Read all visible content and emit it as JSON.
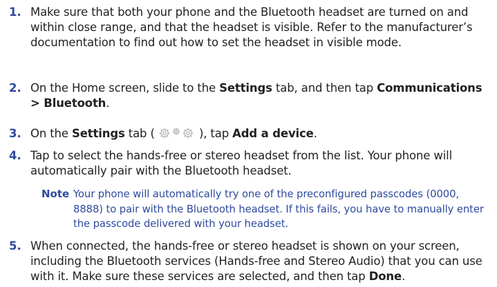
{
  "steps": [
    {
      "number": "1.",
      "text": "Make sure that both your phone and the Bluetooth headset are turned on and within close range, and that the headset is visible. Refer to the manufacturer’s documentation to find out how to set the headset in visible mode."
    },
    {
      "number": "2.",
      "part_a": "On the Home screen, slide to the ",
      "bold_a": "Settings",
      "part_b": " tab, and then tap ",
      "bold_b": "Communications > Bluetooth",
      "part_c": "."
    },
    {
      "number": "3.",
      "part_a": "On the ",
      "bold_a": "Settings",
      "part_b": " tab ( ",
      "icon": "settings-gears-icon",
      "part_c": " ), tap ",
      "bold_b": "Add a device",
      "part_d": "."
    },
    {
      "number": "4.",
      "text": "Tap to select the hands-free or stereo headset from the list. Your phone will automatically pair with the Bluetooth headset."
    },
    {
      "number": "5.",
      "part_a": "When connected, the hands-free or stereo headset is shown on your screen, including the Bluetooth services (Hands-free and Stereo Audio) that you can use with it. Make sure these services are selected, and then tap ",
      "bold_a": "Done",
      "part_b": "."
    }
  ],
  "note": {
    "label": "Note",
    "text": "Your phone will automatically try one of the preconfigured passcodes (0000, 8888) to pair with the Bluetooth headset. If this fails, you have to manually enter the passcode delivered with your headset."
  },
  "colors": {
    "accent": "#2e4a9e",
    "body_text": "#231f20"
  }
}
